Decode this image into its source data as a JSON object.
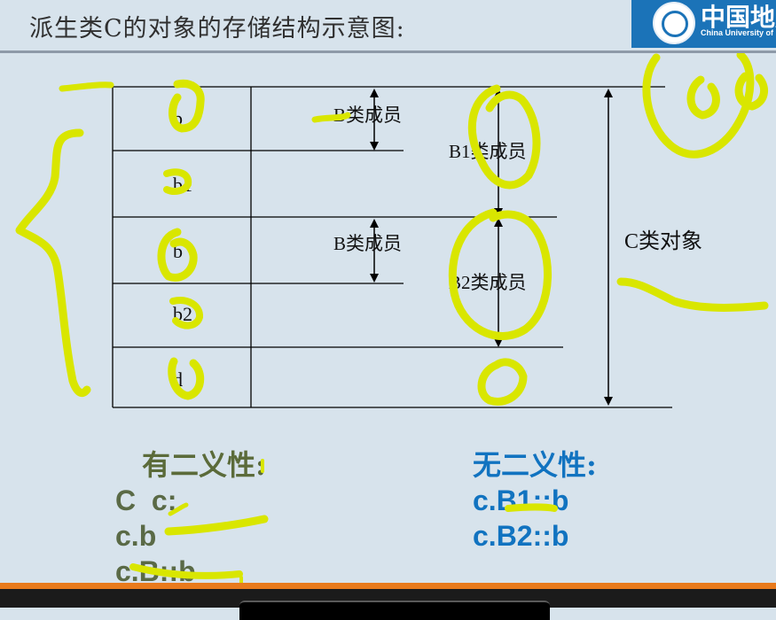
{
  "title": "派生类C的对象的存储结构示意图:",
  "logo": {
    "cn": "中国地质",
    "en": "China University of"
  },
  "diagram": {
    "rows": [
      "b",
      "b1",
      "b",
      "b2",
      "d"
    ],
    "labels": {
      "b_member_1": "B类成员",
      "b1_member": "B1类成员",
      "b_member_2": "B类成员",
      "b2_member": "B2类成员",
      "c_object": "C类对象"
    }
  },
  "ambiguous": {
    "heading": "有二义性:",
    "lines": [
      "C  c;",
      "c.b",
      "c.B::b"
    ]
  },
  "unambiguous": {
    "heading": "无二义性:",
    "lines": [
      "c.B1::b",
      "c.B2::b"
    ]
  },
  "colors": {
    "highlight": "#d9e600",
    "ambiguous_text": "#5a6a46",
    "unambiguous_text": "#1173c0",
    "footer_accent": "#e87a1c"
  }
}
